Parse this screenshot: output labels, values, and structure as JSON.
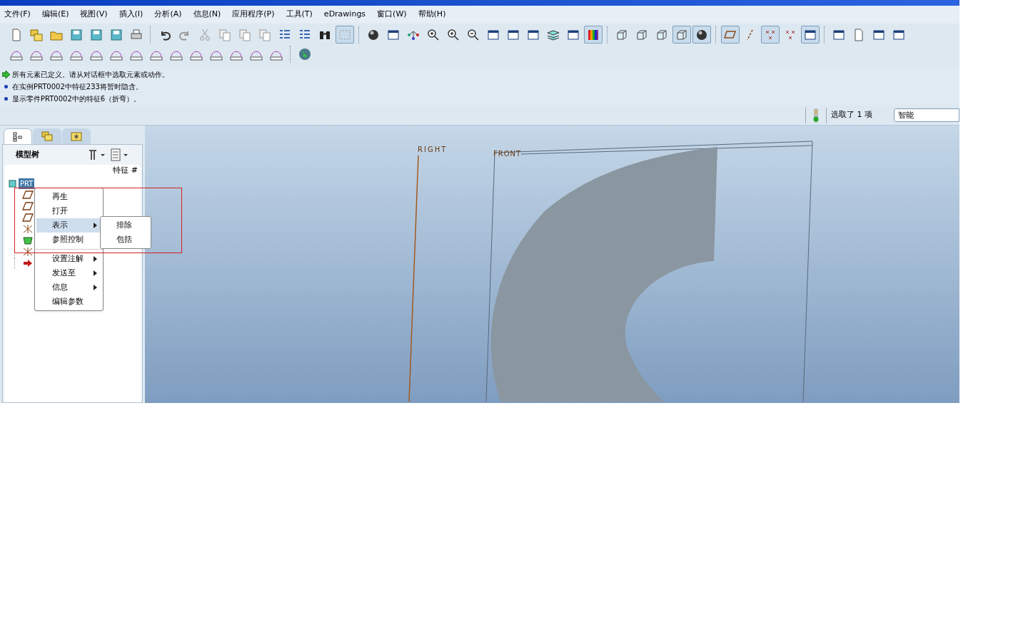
{
  "menu_bar": [
    "文件(F)",
    "编辑(E)",
    "视图(V)",
    "插入(I)",
    "分析(A)",
    "信息(N)",
    "应用程序(P)",
    "工具(T)",
    "eDrawings",
    "窗口(W)",
    "帮助(H)"
  ],
  "toolbar_rows": [
    [
      {
        "kind": "doc",
        "pressed": false
      },
      {
        "kind": "folders",
        "pressed": false
      },
      {
        "kind": "folder",
        "pressed": false
      },
      {
        "kind": "disk",
        "pressed": false
      },
      {
        "kind": "disk",
        "pressed": false
      },
      {
        "kind": "disk",
        "pressed": false
      },
      {
        "kind": "printer",
        "pressed": false
      },
      {
        "kind": "sep"
      },
      {
        "kind": "undo",
        "pressed": false
      },
      {
        "kind": "redo",
        "pressed": false
      },
      {
        "kind": "scissors",
        "pressed": false
      },
      {
        "kind": "copy",
        "pressed": false
      },
      {
        "kind": "copy",
        "pressed": false
      },
      {
        "kind": "copy",
        "pressed": false
      },
      {
        "kind": "list",
        "pressed": false
      },
      {
        "kind": "list",
        "pressed": false
      },
      {
        "kind": "binoculars",
        "pressed": false
      },
      {
        "kind": "selectbox",
        "pressed": true
      },
      {
        "kind": "sep"
      },
      {
        "kind": "sphere",
        "pressed": false
      },
      {
        "kind": "window",
        "pressed": false
      },
      {
        "kind": "nodes",
        "pressed": false
      },
      {
        "kind": "zoomin",
        "pressed": false
      },
      {
        "kind": "zoomin",
        "pressed": false
      },
      {
        "kind": "zoomout",
        "pressed": false
      },
      {
        "kind": "window",
        "pressed": false
      },
      {
        "kind": "window",
        "pressed": false
      },
      {
        "kind": "window",
        "pressed": false
      },
      {
        "kind": "layers",
        "pressed": false
      },
      {
        "kind": "window",
        "pressed": false
      },
      {
        "kind": "colorbar",
        "pressed": true
      },
      {
        "kind": "sep"
      },
      {
        "kind": "cube",
        "pressed": false
      },
      {
        "kind": "cube",
        "pressed": false
      },
      {
        "kind": "cube",
        "pressed": false
      },
      {
        "kind": "cube",
        "pressed": true
      },
      {
        "kind": "sphere",
        "pressed": true
      },
      {
        "kind": "sep"
      },
      {
        "kind": "plane",
        "pressed": true
      },
      {
        "kind": "axis",
        "pressed": false
      },
      {
        "kind": "cross",
        "pressed": true
      },
      {
        "kind": "cross",
        "pressed": false
      },
      {
        "kind": "window",
        "pressed": true
      },
      {
        "kind": "sep"
      },
      {
        "kind": "window",
        "pressed": false
      },
      {
        "kind": "doc",
        "pressed": false
      },
      {
        "kind": "window",
        "pressed": false
      },
      {
        "kind": "window",
        "pressed": false
      }
    ],
    [
      {
        "kind": "ruler",
        "pressed": false
      },
      {
        "kind": "ruler",
        "pressed": false
      },
      {
        "kind": "ruler",
        "pressed": false
      },
      {
        "kind": "ruler",
        "pressed": false
      },
      {
        "kind": "ruler",
        "pressed": false
      },
      {
        "kind": "ruler",
        "pressed": false
      },
      {
        "kind": "ruler",
        "pressed": false
      },
      {
        "kind": "ruler",
        "pressed": false
      },
      {
        "kind": "ruler",
        "pressed": false
      },
      {
        "kind": "ruler",
        "pressed": false
      },
      {
        "kind": "ruler",
        "pressed": false
      },
      {
        "kind": "ruler",
        "pressed": false
      },
      {
        "kind": "ruler",
        "pressed": false
      },
      {
        "kind": "ruler",
        "pressed": false
      },
      {
        "kind": "sep"
      },
      {
        "kind": "globe",
        "pressed": false
      }
    ]
  ],
  "messages": [
    {
      "kind": "prompt",
      "text": "所有元素已定义。请从对话框中选取元素或动作。"
    },
    {
      "kind": "info",
      "text": "在实例PRT0002中特征233将暂时隐含。"
    },
    {
      "kind": "info",
      "text": "显示零件PRT0002中的特征6（折弯）。"
    }
  ],
  "status": {
    "selection": "选取了 1 项",
    "filter": "智能"
  },
  "panel_tabs": [
    {
      "kind": "tree",
      "selected": true
    },
    {
      "kind": "folders",
      "selected": false
    },
    {
      "kind": "favorites",
      "selected": false
    }
  ],
  "model_tree": {
    "title": "模型树",
    "column": "特征 #",
    "root": "PRT",
    "items": [
      {
        "kind": "plane"
      },
      {
        "kind": "plane"
      },
      {
        "kind": "plane"
      },
      {
        "kind": "csys"
      },
      {
        "kind": "feature"
      },
      {
        "kind": "csys"
      },
      {
        "kind": "insert"
      }
    ]
  },
  "context_menu": [
    {
      "label": "再生",
      "submenu": false,
      "selected": false
    },
    {
      "label": "打开",
      "submenu": false,
      "selected": false
    },
    {
      "label": "表示",
      "submenu": true,
      "selected": true
    },
    {
      "label": "参照控制",
      "submenu": false,
      "selected": false
    },
    {
      "label": "设置注解",
      "submenu": true,
      "selected": false
    },
    {
      "label": "发送至",
      "submenu": true,
      "selected": false
    },
    {
      "label": "信息",
      "submenu": true,
      "selected": false
    },
    {
      "label": "编辑参数",
      "submenu": false,
      "selected": false
    }
  ],
  "submenu": [
    "排除",
    "包括"
  ],
  "viewport": {
    "datum_labels": [
      "RIGHT",
      "FRONT"
    ]
  }
}
